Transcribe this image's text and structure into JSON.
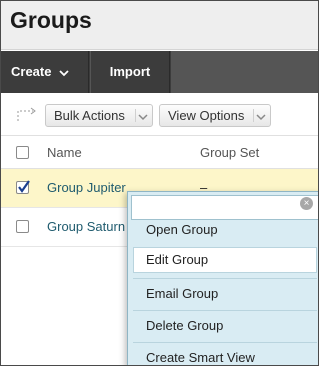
{
  "page": {
    "title": "Groups"
  },
  "action_bar": {
    "create_label": "Create",
    "import_label": "Import"
  },
  "toolbar": {
    "bulk_actions_label": "Bulk Actions",
    "view_options_label": "View Options"
  },
  "table": {
    "columns": [
      "Name",
      "Group Set"
    ],
    "rows": [
      {
        "name": "Group Jupiter",
        "group_set": "–",
        "checked": true
      },
      {
        "name": "Group Saturn",
        "group_set": "",
        "checked": false
      }
    ]
  },
  "context_menu": {
    "search_value": "",
    "items": [
      "Open Group",
      "Edit Group",
      "Email Group",
      "Delete Group",
      "Create Smart View"
    ],
    "highlighted_item": "Edit Group"
  },
  "colors": {
    "action_bar": "#3c3c3c",
    "selected_row": "#fdf6c9",
    "menu_background": "#d9ecf3",
    "link": "#1f5b6e"
  }
}
